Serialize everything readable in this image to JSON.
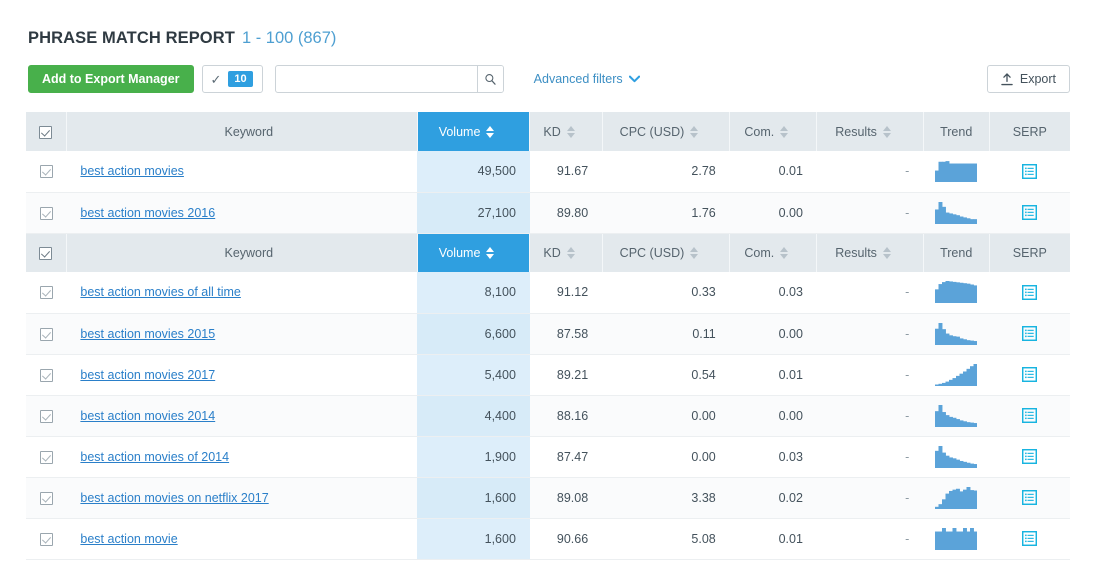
{
  "header": {
    "title": "PHRASE MATCH REPORT",
    "range": "1 - 100 (867)"
  },
  "toolbar": {
    "add_to_export_manager_label": "Add to Export Manager",
    "selection_count": "10",
    "check_glyph": "✓",
    "search_value": "",
    "search_placeholder": "",
    "search_icon": "search-icon",
    "advanced_filters_label": "Advanced filters",
    "chevron_glyph": "⌄",
    "export_label": "Export",
    "export_icon": "upload-icon"
  },
  "table": {
    "columns": [
      {
        "key": "checkbox",
        "label": ""
      },
      {
        "key": "keyword",
        "label": "Keyword",
        "sortable": false
      },
      {
        "key": "volume",
        "label": "Volume",
        "sortable": true,
        "active": true
      },
      {
        "key": "kd",
        "label": "KD",
        "sortable": true
      },
      {
        "key": "cpc",
        "label": "CPC (USD)",
        "sortable": true
      },
      {
        "key": "com",
        "label": "Com.",
        "sortable": true
      },
      {
        "key": "results",
        "label": "Results",
        "sortable": true
      },
      {
        "key": "trend",
        "label": "Trend",
        "sortable": false
      },
      {
        "key": "serp",
        "label": "SERP",
        "sortable": false
      }
    ],
    "group_one": [
      {
        "checked": true,
        "keyword": "best action movies",
        "volume": "49,500",
        "kd": "91.67",
        "cpc": "2.78",
        "com": "0.01",
        "results": "-",
        "trend": [
          52,
          92,
          92,
          95,
          84,
          84,
          84,
          84,
          84,
          84,
          84,
          84
        ],
        "serp": "serp-list-icon"
      },
      {
        "checked": true,
        "keyword": "best action movies 2016",
        "volume": "27,100",
        "kd": "89.80",
        "cpc": "1.76",
        "com": "0.00",
        "results": "-",
        "trend": [
          66,
          100,
          78,
          52,
          48,
          44,
          40,
          34,
          30,
          26,
          22,
          22
        ],
        "serp": "serp-list-icon"
      }
    ],
    "group_two": [
      {
        "checked": true,
        "keyword": "best action movies of all time",
        "volume": "8,100",
        "kd": "91.12",
        "cpc": "0.33",
        "com": "0.03",
        "results": "-",
        "trend": [
          62,
          86,
          95,
          100,
          98,
          96,
          94,
          92,
          90,
          88,
          84,
          80
        ],
        "serp": "serp-list-icon"
      },
      {
        "checked": true,
        "keyword": "best action movies 2015",
        "volume": "6,600",
        "kd": "87.58",
        "cpc": "0.11",
        "com": "0.00",
        "results": "-",
        "trend": [
          74,
          100,
          72,
          52,
          44,
          40,
          38,
          30,
          26,
          22,
          20,
          18
        ],
        "serp": "serp-list-icon"
      },
      {
        "checked": true,
        "keyword": "best action movies 2017",
        "volume": "5,400",
        "kd": "89.21",
        "cpc": "0.54",
        "com": "0.01",
        "results": "-",
        "trend": [
          6,
          10,
          14,
          20,
          28,
          36,
          46,
          56,
          66,
          78,
          90,
          100
        ],
        "serp": "serp-list-icon"
      },
      {
        "checked": true,
        "keyword": "best action movies 2014",
        "volume": "4,400",
        "kd": "88.16",
        "cpc": "0.00",
        "com": "0.00",
        "results": "-",
        "trend": [
          72,
          100,
          68,
          54,
          46,
          42,
          36,
          30,
          26,
          22,
          20,
          18
        ],
        "serp": "serp-list-icon"
      },
      {
        "checked": true,
        "keyword": "best action movies of 2014",
        "volume": "1,900",
        "kd": "87.47",
        "cpc": "0.00",
        "com": "0.03",
        "results": "-",
        "trend": [
          78,
          100,
          70,
          56,
          48,
          44,
          38,
          32,
          28,
          24,
          20,
          18
        ],
        "serp": "serp-list-icon"
      },
      {
        "checked": true,
        "keyword": "best action movies on netflix 2017",
        "volume": "1,600",
        "kd": "89.08",
        "cpc": "3.38",
        "com": "0.02",
        "results": "-",
        "trend": [
          10,
          22,
          44,
          70,
          82,
          88,
          92,
          80,
          88,
          100,
          86,
          84
        ],
        "serp": "serp-list-icon"
      },
      {
        "checked": true,
        "keyword": "best action movie",
        "volume": "1,600",
        "kd": "90.66",
        "cpc": "5.08",
        "com": "0.01",
        "results": "-",
        "trend": [
          84,
          84,
          100,
          84,
          84,
          100,
          84,
          84,
          100,
          84,
          100,
          84
        ],
        "serp": "serp-list-icon"
      }
    ]
  },
  "colors": {
    "accent_blue": "#2f9fe0",
    "green": "#48b04b",
    "link": "#2a7fc9",
    "header_bg": "#e3e9ed",
    "volume_cell": "#ddeefa",
    "serp_icon": "#17b4e0",
    "spark_bar": "#5ba3d9"
  }
}
